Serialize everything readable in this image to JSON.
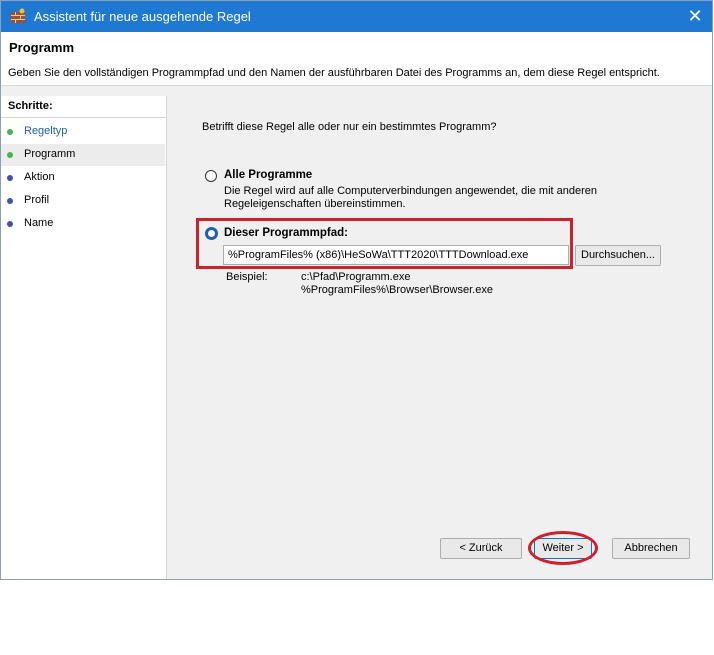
{
  "window": {
    "title": "Assistent für neue ausgehende Regel",
    "close_glyph": "✕"
  },
  "header": {
    "title": "Programm",
    "description": "Geben Sie den vollständigen Programmpfad und den Namen der ausführbaren Datei des Programms an, dem diese Regel entspricht."
  },
  "sidebar": {
    "title": "Schritte:",
    "items": [
      {
        "label": "Regeltyp",
        "dot_color": "#4caf50",
        "active": false
      },
      {
        "label": "Programm",
        "dot_color": "#4caf50",
        "active": true
      },
      {
        "label": "Aktion",
        "dot_color": "#3f51b5",
        "active": false
      },
      {
        "label": "Profil",
        "dot_color": "#3f51b5",
        "active": false
      },
      {
        "label": "Name",
        "dot_color": "#3f51b5",
        "active": false
      }
    ]
  },
  "main": {
    "question": "Betrifft diese Regel alle oder nur ein bestimmtes Programm?",
    "option_all": {
      "label": "Alle Programme",
      "description": "Die Regel wird auf alle Computerverbindungen angewendet, die mit anderen Regeleigenschaften übereinstimmen.",
      "selected": false
    },
    "option_path": {
      "label": "Dieser Programmpfad:",
      "value": "%ProgramFiles% (x86)\\HeSoWa\\TTT2020\\TTTDownload.exe",
      "selected": true
    },
    "browse_label": "Durchsuchen...",
    "example_label": "Beispiel:",
    "example_values": [
      "c:\\Pfad\\Programm.exe",
      "%ProgramFiles%\\Browser\\Browser.exe"
    ]
  },
  "footer": {
    "back_label": "< Zurück",
    "next_label": "Weiter >",
    "cancel_label": "Abbrechen"
  },
  "annotation_color": "#d0202a"
}
